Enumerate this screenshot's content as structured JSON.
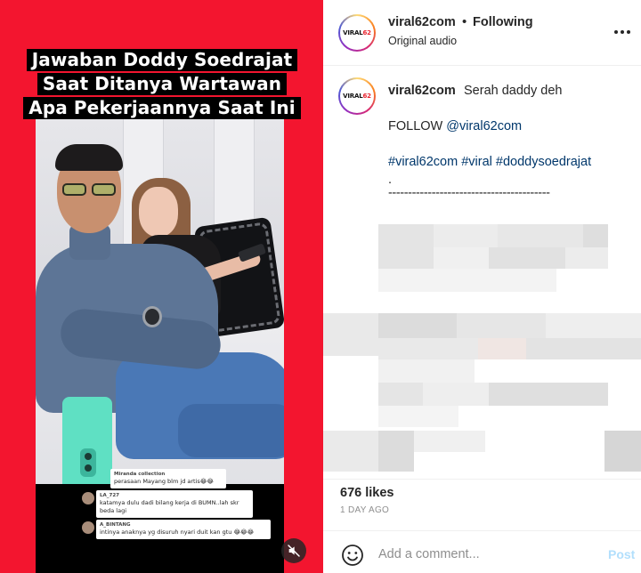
{
  "video": {
    "title_lines": [
      "Jawaban Doddy Soedrajat",
      "Saat Ditanya Wartawan",
      "Apa Pekerjaannya Saat Ini"
    ],
    "overlay_comments": [
      {
        "name": "Miranda collection",
        "text": "perasaan Mayang blm jd artis😂😂"
      },
      {
        "name": "LA_727",
        "text": "katamya dulu dadi bilang kerja di BUMN..lah skr beda lagi"
      },
      {
        "name": "A_BINTANG",
        "text": "intinya anaknya yg disuruh nyari duit kan gtu 😂😂😂"
      }
    ],
    "background_color": "#f3152f",
    "mute_icon": "speaker-muted-icon"
  },
  "post": {
    "header": {
      "username": "viral62com",
      "separator": "•",
      "follow_status": "Following",
      "audio": "Original audio",
      "avatar_logo": {
        "prefix": "VIRAL",
        "suffix": "62"
      }
    },
    "caption": {
      "username": "viral62com",
      "text": "Serah daddy deh",
      "follow_prefix": "FOLLOW ",
      "mention": "@viral62com",
      "hashtags": [
        "#viral62com",
        "#viral",
        "#doddysoedrajat"
      ],
      "dot": ".",
      "divider": "-----------------------------------------"
    },
    "likes": "676 likes",
    "time": "1 DAY AGO",
    "comment_box": {
      "placeholder": "Add a comment...",
      "post_label": "Post"
    }
  },
  "colors": {
    "link": "#00376b",
    "muted": "#8e8e8e",
    "post_disabled": "#b2dffc"
  }
}
